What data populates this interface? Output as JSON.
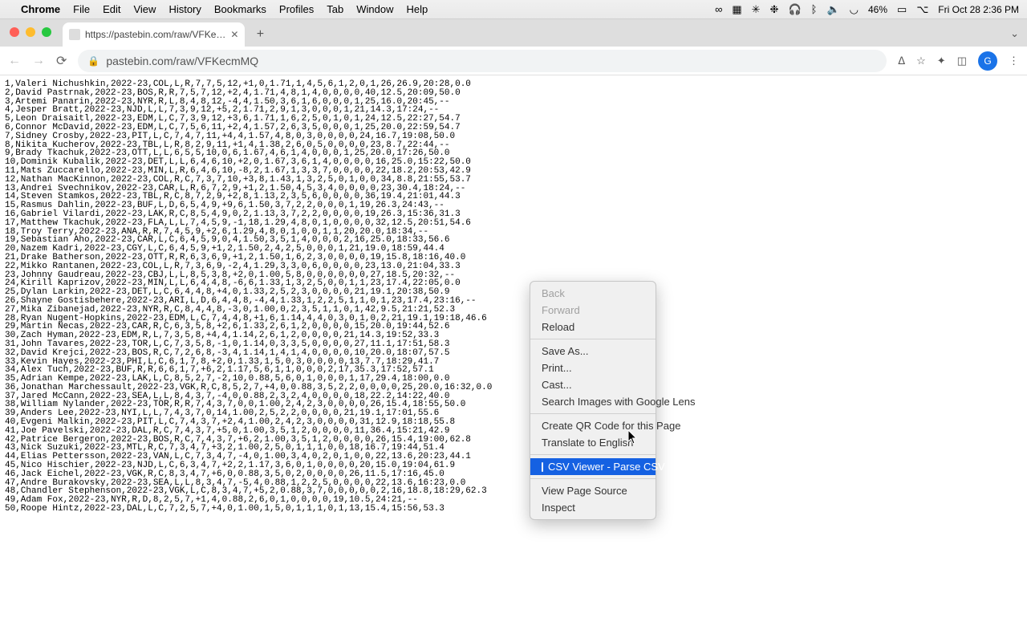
{
  "menubar": {
    "app": "Chrome",
    "items": [
      "File",
      "Edit",
      "View",
      "History",
      "Bookmarks",
      "Profiles",
      "Tab",
      "Window",
      "Help"
    ],
    "battery": "46%",
    "datetime": "Fri Oct 28  2:36 PM"
  },
  "tab": {
    "title": "https://pastebin.com/raw/VFKe…"
  },
  "url": "pastebin.com/raw/VFKecmMQ",
  "avatar_initial": "G",
  "context_menu": {
    "back": "Back",
    "forward": "Forward",
    "reload": "Reload",
    "save_as": "Save As...",
    "print": "Print...",
    "cast": "Cast...",
    "search_images": "Search Images with Google Lens",
    "qr": "Create QR Code for this Page",
    "translate": "Translate to English",
    "csv_viewer": "CSV Viewer - Parse CSV",
    "view_source": "View Page Source",
    "inspect": "Inspect"
  },
  "csv_lines": [
    "1,Valeri Nichushkin,2022-23,COL,L,R,7,7,5,12,+1,0,1.71,1,4,5,6,1,2,0,1,26,26.9,20:28,0.0",
    "2,David Pastrnak,2022-23,BOS,R,R,7,5,7,12,+2,4,1.71,4,8,1,4,0,0,0,0,40,12.5,20:09,50.0",
    "3,Artemi Panarin,2022-23,NYR,R,L,8,4,8,12,-4,4,1.50,3,6,1,6,0,0,0,1,25,16.0,20:45,--",
    "4,Jesper Bratt,2022-23,NJD,L,L,7,3,9,12,+5,2,1.71,2,9,1,3,0,0,0,1,21,14.3,17:24,--",
    "5,Leon Draisaitl,2022-23,EDM,L,C,7,3,9,12,+3,6,1.71,1,6,2,5,0,1,0,1,24,12.5,22:27,54.7",
    "6,Connor McDavid,2022-23,EDM,L,C,7,5,6,11,+2,4,1.57,2,6,3,5,0,0,0,1,25,20.0,22:59,54.7",
    "7,Sidney Crosby,2022-23,PIT,L,C,7,4,7,11,+4,4,1.57,4,8,0,3,0,0,0,0,24,16.7,19:08,50.0",
    "8,Nikita Kucherov,2022-23,TBL,L,R,8,2,9,11,+1,4,1.38,2,6,0,5,0,0,0,0,23,8.7,22:44,--",
    "9,Brady Tkachuk,2022-23,OTT,L,L,6,5,5,10,0,6,1.67,4,6,1,4,0,0,0,1,25,20.0,17:26,50.0",
    "10,Dominik Kubalik,2022-23,DET,L,L,6,4,6,10,+2,0,1.67,3,6,1,4,0,0,0,0,16,25.0,15:22,50.0",
    "11,Mats Zuccarello,2022-23,MIN,L,R,6,4,6,10,-8,2,1.67,1,3,3,7,0,0,0,0,22,18.2,20:53,42.9",
    "12,Nathan MacKinnon,2022-23,COL,R,C,7,3,7,10,+3,8,1.43,1,3,2,5,0,1,0,0,34,8.8,21:55,53.7",
    "13,Andrei Svechnikov,2022-23,CAR,L,R,6,7,2,9,+1,2,1.50,4,5,3,4,0,0,0,0,23,30.4,18:24,--",
    "14,Steven Stamkos,2022-23,TBL,R,C,8,7,2,9,+2,8,1.13,2,3,5,6,0,0,0,0,36,19.4,21:01,44.3",
    "15,Rasmus Dahlin,2022-23,BUF,L,D,6,5,4,9,+9,6,1.50,3,7,2,2,0,0,0,1,19,26.3,24:43,--",
    "16,Gabriel Vilardi,2022-23,LAK,R,C,8,5,4,9,0,2,1.13,3,7,2,2,0,0,0,0,19,26.3,15:36,31.3",
    "17,Matthew Tkachuk,2022-23,FLA,L,L,7,4,5,9,-1,18,1.29,4,8,0,1,0,0,0,0,32,12.5,20:51,54.6",
    "18,Troy Terry,2022-23,ANA,R,R,7,4,5,9,+2,6,1.29,4,8,0,1,0,0,1,1,20,20.0,18:34,--",
    "19,Sebastian Aho,2022-23,CAR,L,C,6,4,5,9,0,4,1.50,3,5,1,4,0,0,0,2,16,25.0,18:33,56.6",
    "20,Nazem Kadri,2022-23,CGY,L,C,6,4,5,9,+1,2,1.50,2,4,2,5,0,0,0,1,21,19.0,18:59,44.4",
    "21,Drake Batherson,2022-23,OTT,R,R,6,3,6,9,+1,2,1.50,1,6,2,3,0,0,0,0,19,15.8,18:16,40.0",
    "22,Mikko Rantanen,2022-23,COL,L,R,7,3,6,9,-2,4,1.29,3,3,0,6,0,0,0,0,23,13.0,21:04,33.3",
    "23,Johnny Gaudreau,2022-23,CBJ,L,L,8,5,3,8,+2,0,1.00,5,8,0,0,0,0,0,0,27,18.5,20:32,--",
    "24,Kirill Kaprizov,2022-23,MIN,L,L,6,4,4,8,-6,6,1.33,1,3,2,5,0,0,1,1,23,17.4,22:05,0.0",
    "25,Dylan Larkin,2022-23,DET,L,C,6,4,4,8,+4,0,1.33,2,5,2,3,0,0,0,0,21,19.1,20:38,50.9",
    "26,Shayne Gostisbehere,2022-23,ARI,L,D,6,4,4,8,-4,4,1.33,1,2,2,5,1,1,0,1,23,17.4,23:16,--",
    "27,Mika Zibanejad,2022-23,NYR,R,C,8,4,4,8,-3,0,1.00,0,2,3,5,1,1,0,1,42,9.5,21:21,52.3",
    "28,Ryan Nugent-Hopkins,2022-23,EDM,L,C,7,4,4,8,+1,6,1.14,4,4,0,3,0,1,0,2,21,19.1,19:18,46.6",
    "29,Martin Necas,2022-23,CAR,R,C,6,3,5,8,+2,6,1.33,2,6,1,2,0,0,0,0,15,20.0,19:44,52.6",
    "30,Zach Hyman,2022-23,EDM,R,L,7,3,5,8,+4,4,1.14,2,6,1,2,0,0,0,0,21,14.3,19:52,33.3",
    "31,John Tavares,2022-23,TOR,L,C,7,3,5,8,-1,0,1.14,0,3,3,5,0,0,0,0,27,11.1,17:51,58.3",
    "32,David Krejci,2022-23,BOS,R,C,7,2,6,8,-3,4,1.14,1,4,1,4,0,0,0,0,10,20.0,18:07,57.5",
    "33,Kevin Hayes,2022-23,PHI,L,C,6,1,7,8,+2,0,1.33,1,5,0,3,0,0,0,0,13,7.7,18:29,41.7",
    "34,Alex Tuch,2022-23,BUF,R,R,6,6,1,7,+6,2,1.17,5,6,1,1,0,0,0,2,17,35.3,17:52,57.1",
    "35,Adrian Kempe,2022-23,LAK,L,C,8,5,2,7,-2,10,0.88,5,6,0,1,0,0,0,1,17,29.4,18:00,0.0",
    "36,Jonathan Marchessault,2022-23,VGK,R,C,8,5,2,7,+4,0,0.88,3,5,2,2,0,0,0,0,25,20.0,16:32,0.0",
    "37,Jared McCann,2022-23,SEA,L,L,8,4,3,7,-4,0,0.88,2,3,2,4,0,0,0,0,18,22.2,14:22,40.0",
    "38,William Nylander,2022-23,TOR,R,R,7,4,3,7,0,0,1.00,2,4,2,3,0,0,0,0,26,15.4,18:55,50.0",
    "39,Anders Lee,2022-23,NYI,L,L,7,4,3,7,0,14,1.00,2,5,2,2,0,0,0,0,21,19.1,17:01,55.6",
    "40,Evgeni Malkin,2022-23,PIT,L,C,7,4,3,7,+2,4,1.00,2,4,2,3,0,0,0,0,31,12.9,18:18,55.8",
    "41,Joe Pavelski,2022-23,DAL,R,C,7,4,3,7,+5,0,1.00,3,5,1,2,0,0,0,0,11,36.4,15:21,42.9",
    "42,Patrice Bergeron,2022-23,BOS,R,C,7,4,3,7,+6,2,1.00,3,5,1,2,0,0,0,0,26,15.4,19:00,62.8",
    "43,Nick Suzuki,2022-23,MTL,R,C,7,3,4,7,+3,2,1.00,2,5,0,1,1,1,0,0,18,16.7,19:44,51.4",
    "44,Elias Pettersson,2022-23,VAN,L,C,7,3,4,7,-4,0,1.00,3,4,0,2,0,1,0,0,22,13.6,20:23,44.1",
    "45,Nico Hischier,2022-23,NJD,L,C,6,3,4,7,+2,2,1.17,3,6,0,1,0,0,0,0,20,15.0,19:04,61.9",
    "46,Jack Eichel,2022-23,VGK,R,C,8,3,4,7,+6,0,0.88,3,5,0,2,0,0,0,0,26,11.5,17:16,45.0",
    "47,Andre Burakovsky,2022-23,SEA,L,L,8,3,4,7,-5,4,0.88,1,2,2,5,0,0,0,0,22,13.6,16:23,0.0",
    "48,Chandler Stephenson,2022-23,VGK,L,C,8,3,4,7,+5,2,0.88,3,7,0,0,0,0,0,2,16,18.8,18:29,62.3",
    "49,Adam Fox,2022-23,NYR,R,D,8,2,5,7,+1,4,0.88,2,6,0,1,0,0,0,0,19,10.5,24:21,--",
    "50,Roope Hintz,2022-23,DAL,L,C,7,2,5,7,+4,0,1.00,1,5,0,1,1,1,0,1,13,15.4,15:56,53.3"
  ]
}
